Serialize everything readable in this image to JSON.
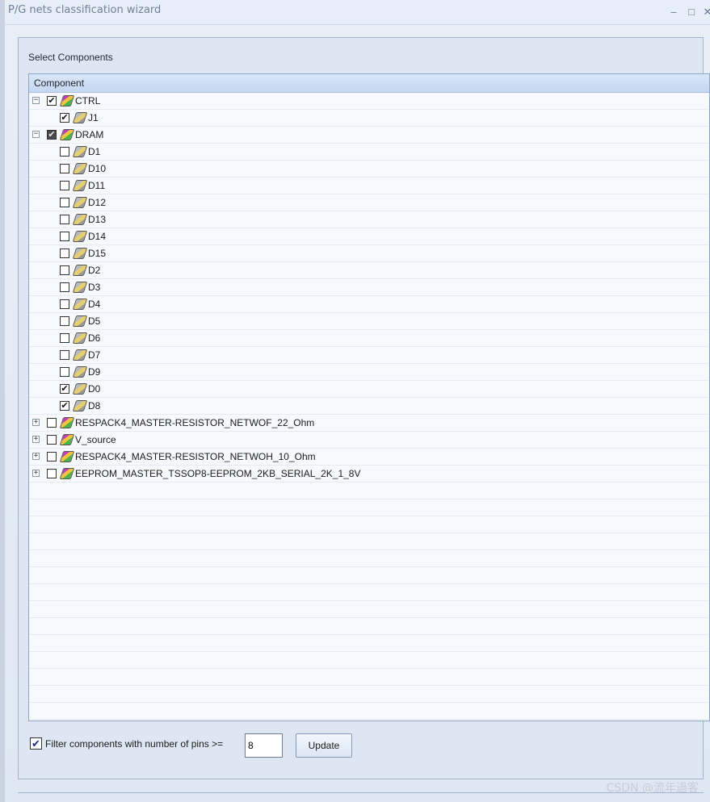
{
  "window": {
    "title": "P/G nets classification wizard",
    "minimize": "–",
    "maximize": "□",
    "close": "✕"
  },
  "panel": {
    "heading": "Select Components",
    "column_header": "Component"
  },
  "tree": [
    {
      "label": "CTRL",
      "level": 0,
      "expander": "minus",
      "check": "checked"
    },
    {
      "label": "J1",
      "level": 1,
      "expander": "",
      "check": "checked"
    },
    {
      "label": "DRAM",
      "level": 0,
      "expander": "minus",
      "check": "partial"
    },
    {
      "label": "D1",
      "level": 1,
      "expander": "",
      "check": "unchecked"
    },
    {
      "label": "D10",
      "level": 1,
      "expander": "",
      "check": "unchecked"
    },
    {
      "label": "D11",
      "level": 1,
      "expander": "",
      "check": "unchecked"
    },
    {
      "label": "D12",
      "level": 1,
      "expander": "",
      "check": "unchecked"
    },
    {
      "label": "D13",
      "level": 1,
      "expander": "",
      "check": "unchecked"
    },
    {
      "label": "D14",
      "level": 1,
      "expander": "",
      "check": "unchecked"
    },
    {
      "label": "D15",
      "level": 1,
      "expander": "",
      "check": "unchecked"
    },
    {
      "label": "D2",
      "level": 1,
      "expander": "",
      "check": "unchecked"
    },
    {
      "label": "D3",
      "level": 1,
      "expander": "",
      "check": "unchecked"
    },
    {
      "label": "D4",
      "level": 1,
      "expander": "",
      "check": "unchecked"
    },
    {
      "label": "D5",
      "level": 1,
      "expander": "",
      "check": "unchecked"
    },
    {
      "label": "D6",
      "level": 1,
      "expander": "",
      "check": "unchecked"
    },
    {
      "label": "D7",
      "level": 1,
      "expander": "",
      "check": "unchecked"
    },
    {
      "label": "D9",
      "level": 1,
      "expander": "",
      "check": "unchecked"
    },
    {
      "label": "D0",
      "level": 1,
      "expander": "",
      "check": "checked"
    },
    {
      "label": "D8",
      "level": 1,
      "expander": "",
      "check": "checked"
    },
    {
      "label": "RESPACK4_MASTER-RESISTOR_NETWOF_22_Ohm",
      "level": 0,
      "expander": "plus",
      "check": "unchecked"
    },
    {
      "label": "V_source",
      "level": 0,
      "expander": "plus",
      "check": "unchecked"
    },
    {
      "label": "RESPACK4_MASTER-RESISTOR_NETWOH_10_Ohm",
      "level": 0,
      "expander": "plus",
      "check": "unchecked"
    },
    {
      "label": "EEPROM_MASTER_TSSOP8-EEPROM_2KB_SERIAL_2K_1_8V",
      "level": 0,
      "expander": "plus",
      "check": "unchecked"
    }
  ],
  "icons": {
    "expanded": "minus-icon",
    "collapsed": "plus-icon",
    "group": "component-group-icon",
    "part": "component-icon",
    "check_mark": "✔"
  },
  "filter": {
    "checked": true,
    "check_mark": "✔",
    "label": "Filter components with number of pins >=",
    "pins_value": "8",
    "update_label": "Update"
  },
  "watermark": "CSDN @流年過客",
  "colors": {
    "header_blue": "#c4d8f1",
    "panel_border": "#9fb3cf"
  }
}
